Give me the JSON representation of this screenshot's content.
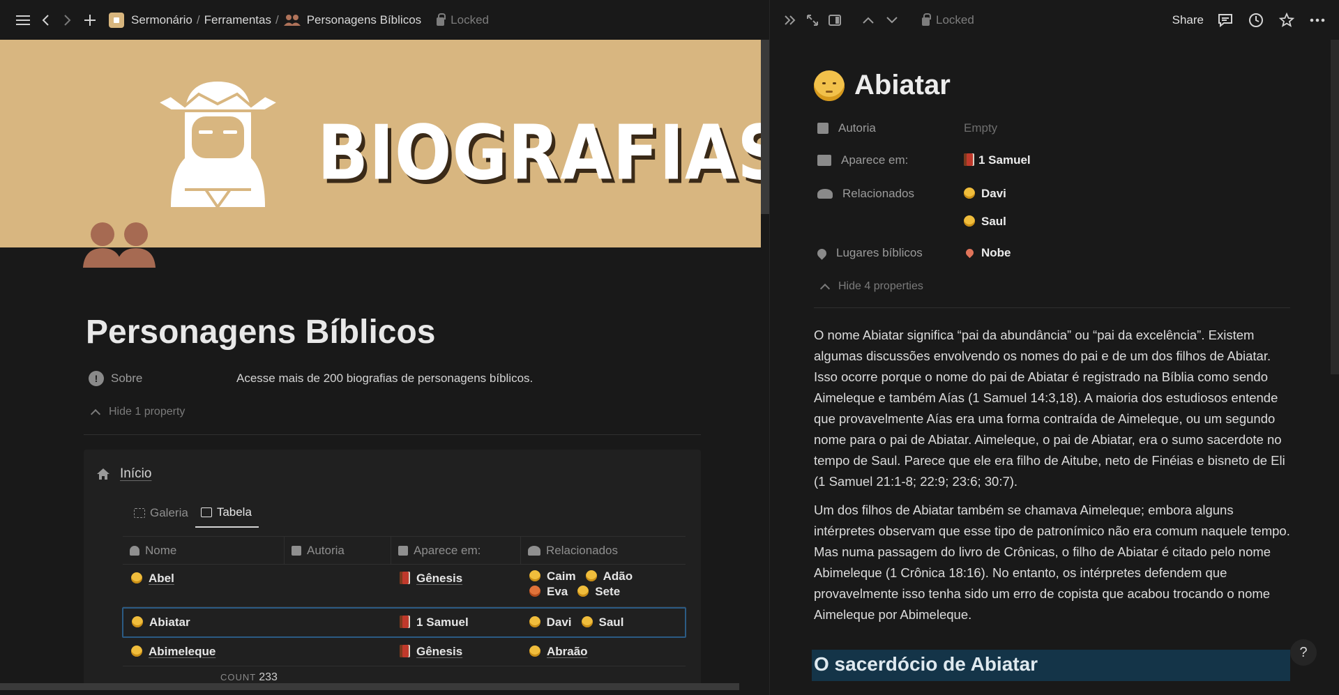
{
  "left": {
    "breadcrumb": {
      "workspace": "Sermonário",
      "section": "Ferramentas",
      "page": "Personagens Bíblicos"
    },
    "locked": "Locked",
    "banner_title": "BIOGRAFIAS",
    "page_title": "Personagens Bíblicos",
    "property": {
      "label": "Sobre",
      "value": "Acesse mais de 200 biografias de personagens bíblicos."
    },
    "hide_property": "Hide 1 property",
    "database": {
      "title": "Início",
      "tabs": [
        {
          "label": "Galeria",
          "active": false
        },
        {
          "label": "Tabela",
          "active": true
        }
      ],
      "columns": [
        "Nome",
        "Autoria",
        "Aparece em:",
        "Relacionados"
      ],
      "rows": [
        {
          "name": "Abel",
          "autoria": "",
          "aparece": "Gênesis",
          "relacionados": [
            "Caim",
            "Adão",
            "Eva",
            "Sete"
          ]
        },
        {
          "name": "Abiatar",
          "autoria": "",
          "aparece": "1 Samuel",
          "relacionados": [
            "Davi",
            "Saul"
          ]
        },
        {
          "name": "Abimeleque",
          "autoria": "",
          "aparece": "Gênesis",
          "relacionados": [
            "Abraão"
          ]
        }
      ],
      "count_label": "COUNT",
      "count_value": "233"
    }
  },
  "right": {
    "locked": "Locked",
    "share": "Share",
    "title": "Abiatar",
    "properties": {
      "autoria": {
        "label": "Autoria",
        "value": "Empty"
      },
      "aparece": {
        "label": "Aparece em:",
        "value": "1 Samuel"
      },
      "relacionados": {
        "label": "Relacionados",
        "values": [
          "Davi",
          "Saul"
        ]
      },
      "lugares": {
        "label": "Lugares bíblicos",
        "value": "Nobe"
      }
    },
    "hide_properties": "Hide 4 properties",
    "paragraphs": [
      "O nome Abiatar significa “pai da abundância” ou “pai da excelência”. Existem algumas discussões envolvendo os nomes do pai e de um dos filhos de Abiatar. Isso ocorre porque o nome do pai de Abiatar é registrado na Bíblia como sendo Aimeleque e também Aías (1 Samuel 14:3,18). A maioria dos estudiosos entende que provavelmente Aías era uma forma contraída de Aimeleque, ou um segundo nome para o pai de Abiatar. Aimeleque, o pai de Abiatar, era o sumo sacerdote no tempo de Saul. Parece que ele era filho de Aitube, neto de Finéias e bisneto de Eli (1 Samuel 21:1-8; 22:9; 23:6; 30:7).",
      "Um dos filhos de Abiatar também se chamava Aimeleque; embora alguns intérpretes observam que esse tipo de patronímico não era comum naquele tempo. Mas numa passagem do livro de Crônicas, o filho de Abiatar é citado pelo nome Abimeleque (1 Crônica 18:16). No entanto, os intérpretes defendem que provavelmente isso tenha sido um erro de copista que acabou trocando o nome Aimeleque por Abimeleque."
    ],
    "heading": "O sacerdócio de Abiatar",
    "help": "?"
  },
  "colors": {
    "banner": "#d8b680",
    "background": "#191919",
    "selection": "#2b5b84",
    "heading_highlight": "#143448"
  }
}
